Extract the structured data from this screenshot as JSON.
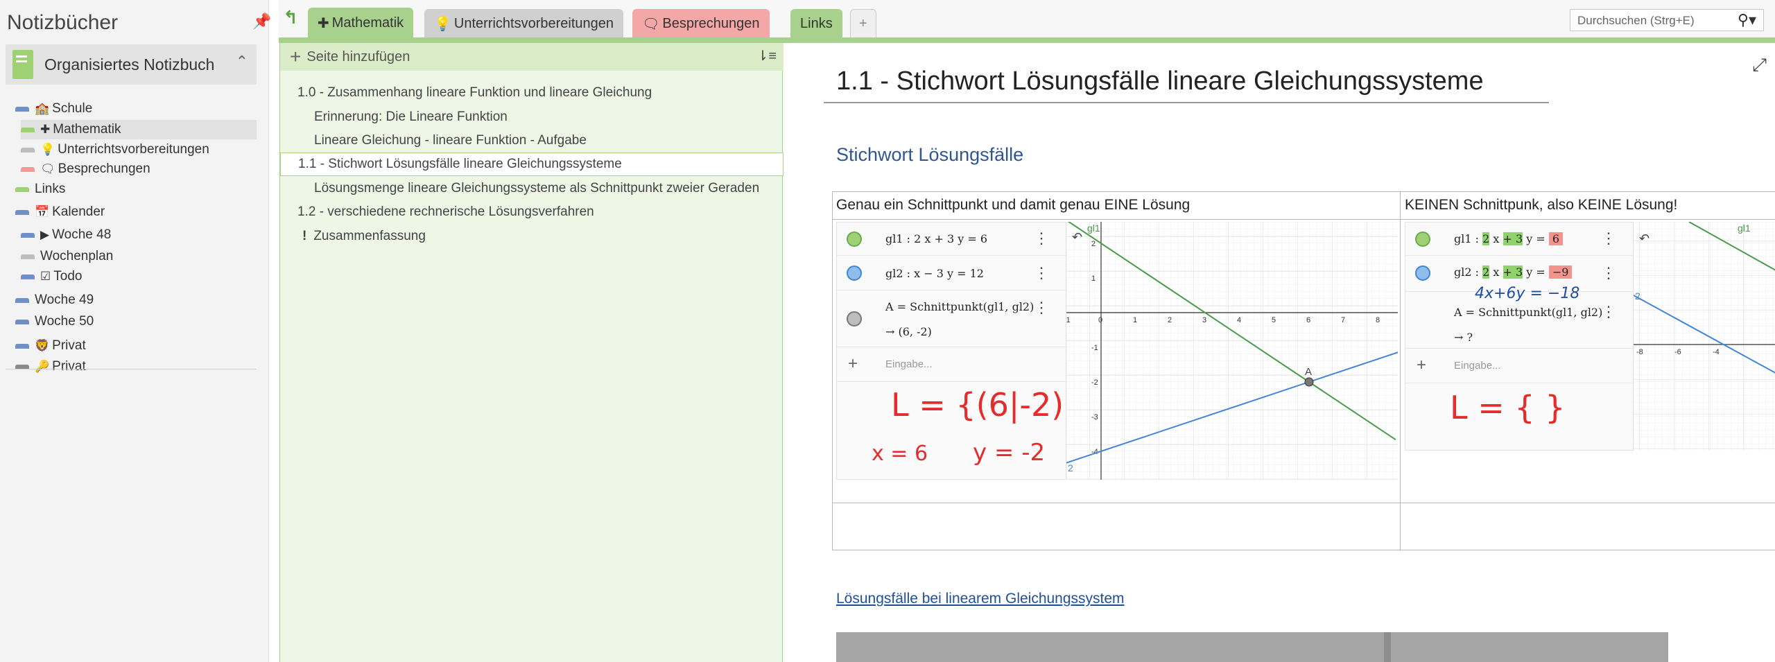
{
  "nav": {
    "title": "Notizbücher",
    "notebook": "Organisiertes Notizbuch",
    "tree": [
      {
        "label": "Schule",
        "icon": "school-icon",
        "stub": "#6f8fc7",
        "indent": 0
      },
      {
        "label": "Mathematik",
        "icon": "plus-icon",
        "stub": "#9ed174",
        "indent": 1,
        "selected": true
      },
      {
        "label": "Unterrichtsvorbereitungen",
        "icon": "lightbulb-icon",
        "stub": "#bdbdbd",
        "indent": 1
      },
      {
        "label": "Besprechungen",
        "icon": "speech-bubbles-icon",
        "stub": "#f19a9a",
        "indent": 1
      },
      {
        "label": "Links",
        "icon": "",
        "stub": "#9ed174",
        "indent": 0
      },
      {
        "label": "Kalender",
        "icon": "calendar-icon",
        "stub": "#6f8fc7",
        "indent": 0
      },
      {
        "label": "Woche 48",
        "icon": "play-icon",
        "stub": "#6f8fc7",
        "indent": 1
      },
      {
        "label": "Wochenplan",
        "icon": "",
        "stub": "#bdbdbd",
        "indent": 1
      },
      {
        "label": "Todo",
        "icon": "checkbox-icon",
        "stub": "#6f8fc7",
        "indent": 1
      },
      {
        "label": "Woche 49",
        "icon": "",
        "stub": "#6f8fc7",
        "indent": 0
      },
      {
        "label": "Woche 50",
        "icon": "",
        "stub": "#6f8fc7",
        "indent": 0
      },
      {
        "label": "Privat",
        "icon": "lion-icon",
        "stub": "#6f8fc7",
        "indent": 0
      },
      {
        "label": "Privat",
        "icon": "key-icon",
        "stub": "#8a8a8a",
        "indent": 0
      }
    ]
  },
  "tabs": [
    {
      "label": "Mathematik",
      "icon": "plus-icon",
      "color": "#a9d18e",
      "active": true
    },
    {
      "label": "Unterrichtsvorbereitungen",
      "icon": "lightbulb-icon",
      "color": "#d0d0d0"
    },
    {
      "label": "Besprechungen",
      "icon": "speech-bubbles-icon",
      "color": "#f4a7a7"
    },
    {
      "label": "Links",
      "icon": "",
      "color": "#a9d18e"
    },
    {
      "label": "+",
      "icon": "",
      "color": "#efefef"
    }
  ],
  "search": {
    "placeholder": "Durchsuchen (Strg+E)"
  },
  "pages": {
    "add_label": "Seite hinzufügen",
    "items": [
      {
        "label": "1.0 - Zusammenhang lineare Funktion und lineare Gleichung",
        "indent": 0
      },
      {
        "label": "Erinnerung: Die Lineare Funktion",
        "indent": 1
      },
      {
        "label": "Lineare Gleichung - lineare Funktion - Aufgabe",
        "indent": 1
      },
      {
        "label": "1.1 - Stichwort Lösungsfälle lineare Gleichungssysteme",
        "indent": 0,
        "selected": true
      },
      {
        "label": "Lösungsmenge lineare Gleichungssysteme als Schnittpunkt zweier Geraden",
        "indent": 1
      },
      {
        "label": "1.2 - verschiedene rechnerische Lösungsverfahren",
        "indent": 0
      },
      {
        "label": "Zusammenfassung",
        "indent": 0,
        "icon": "exclamation-icon"
      }
    ]
  },
  "page": {
    "title": "1.1 - Stichwort Lösungsfälle lineare Gleichungssysteme",
    "subheading": "Stichwort Lösungsfälle",
    "link": "Lösungsfälle bei linearem Gleichungssystem",
    "col1": {
      "header": "Genau ein Schnittpunkt und damit genau EINE Lösung",
      "eq1": "gl1 : 2 x + 3 y = 6",
      "eq2": "gl2 : x − 3 y = 12",
      "cmd": "A = Schnittpunkt(gl1, gl2)",
      "result": "→ (6, -2)",
      "input": "Eingabe...",
      "hw_set": "L = {(6|-2)}",
      "hw_x": "x = 6",
      "hw_y": "y = -2",
      "graph_label_line": "gl1",
      "graph_label_point": "A",
      "graph_label_2": "2",
      "xticks": [
        "-1",
        "0",
        "1",
        "2",
        "3",
        "4",
        "5",
        "6",
        "7",
        "8"
      ],
      "yticks": [
        "2",
        "1",
        "-1",
        "-2",
        "-3",
        "-4"
      ]
    },
    "col2": {
      "header": "KEINEN Schnittpunk, also KEINE Lösung!",
      "eq1_a": "gl1 : ",
      "eq1_b": "2",
      "eq1_c": " x ",
      "eq1_d": "+ 3",
      "eq1_e": " y = ",
      "eq1_f": "6",
      "eq2_a": "gl2 : ",
      "eq2_b": "2",
      "eq2_c": " x ",
      "eq2_d": "+ 3",
      "eq2_e": " y = ",
      "eq2_f": "−9",
      "hw_note": "4x+6y = −18",
      "cmd": "A = Schnittpunkt(gl1, gl2)",
      "result": "→ ?",
      "input": "Eingabe...",
      "hw_set": "L = { }",
      "graph_label_line": "gl1",
      "graph_label_2": "2",
      "xticks": [
        "-8",
        "-6",
        "-4"
      ]
    }
  },
  "colors": {
    "green": "#a9d18e",
    "line_green": "#4a9a4a",
    "line_blue": "#3f86d6",
    "ink_red": "#e52b2b",
    "heading_blue": "#2f5597"
  }
}
